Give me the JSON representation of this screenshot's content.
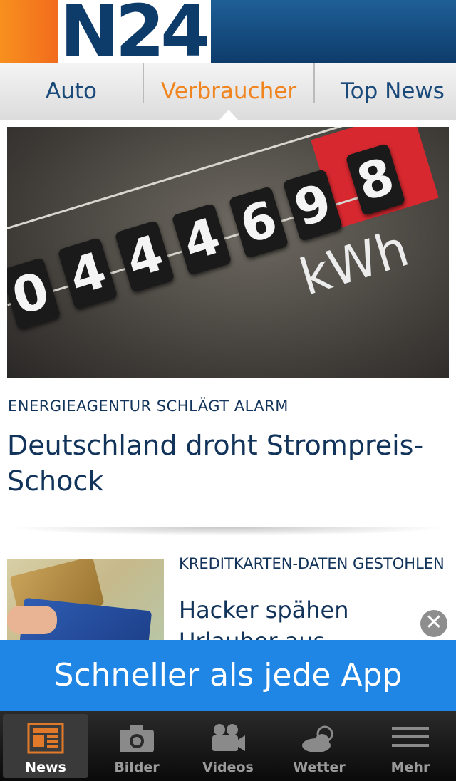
{
  "header": {
    "logo": "N24"
  },
  "tabs": [
    {
      "label": "Auto",
      "active": false
    },
    {
      "label": "Verbraucher",
      "active": true
    },
    {
      "label": "Top News",
      "active": false
    }
  ],
  "hero": {
    "digits": [
      "0",
      "4",
      "4",
      "4",
      "6",
      "9",
      "8"
    ],
    "unit": "kWh",
    "kicker": "ENERGIEAGENTUR SCHLÄGT ALARM",
    "headline": "Deutschland droht Strompreis-Schock"
  },
  "article2": {
    "kicker": "KREDITKARTEN-DATEN GESTOHLEN",
    "headline": "Hacker spähen Urlauber aus"
  },
  "banner": {
    "text": "Schneller als jede App",
    "close_icon": "close-icon"
  },
  "tabbar": [
    {
      "label": "News",
      "icon": "newspaper-icon",
      "active": true
    },
    {
      "label": "Bilder",
      "icon": "camera-icon",
      "active": false
    },
    {
      "label": "Videos",
      "icon": "video-camera-icon",
      "active": false
    },
    {
      "label": "Wetter",
      "icon": "weather-icon",
      "active": false
    },
    {
      "label": "Mehr",
      "icon": "menu-icon",
      "active": false
    }
  ],
  "colors": {
    "brand_blue": "#0d3c6b",
    "accent_orange": "#f0851f",
    "banner_blue": "#1f86e6"
  }
}
